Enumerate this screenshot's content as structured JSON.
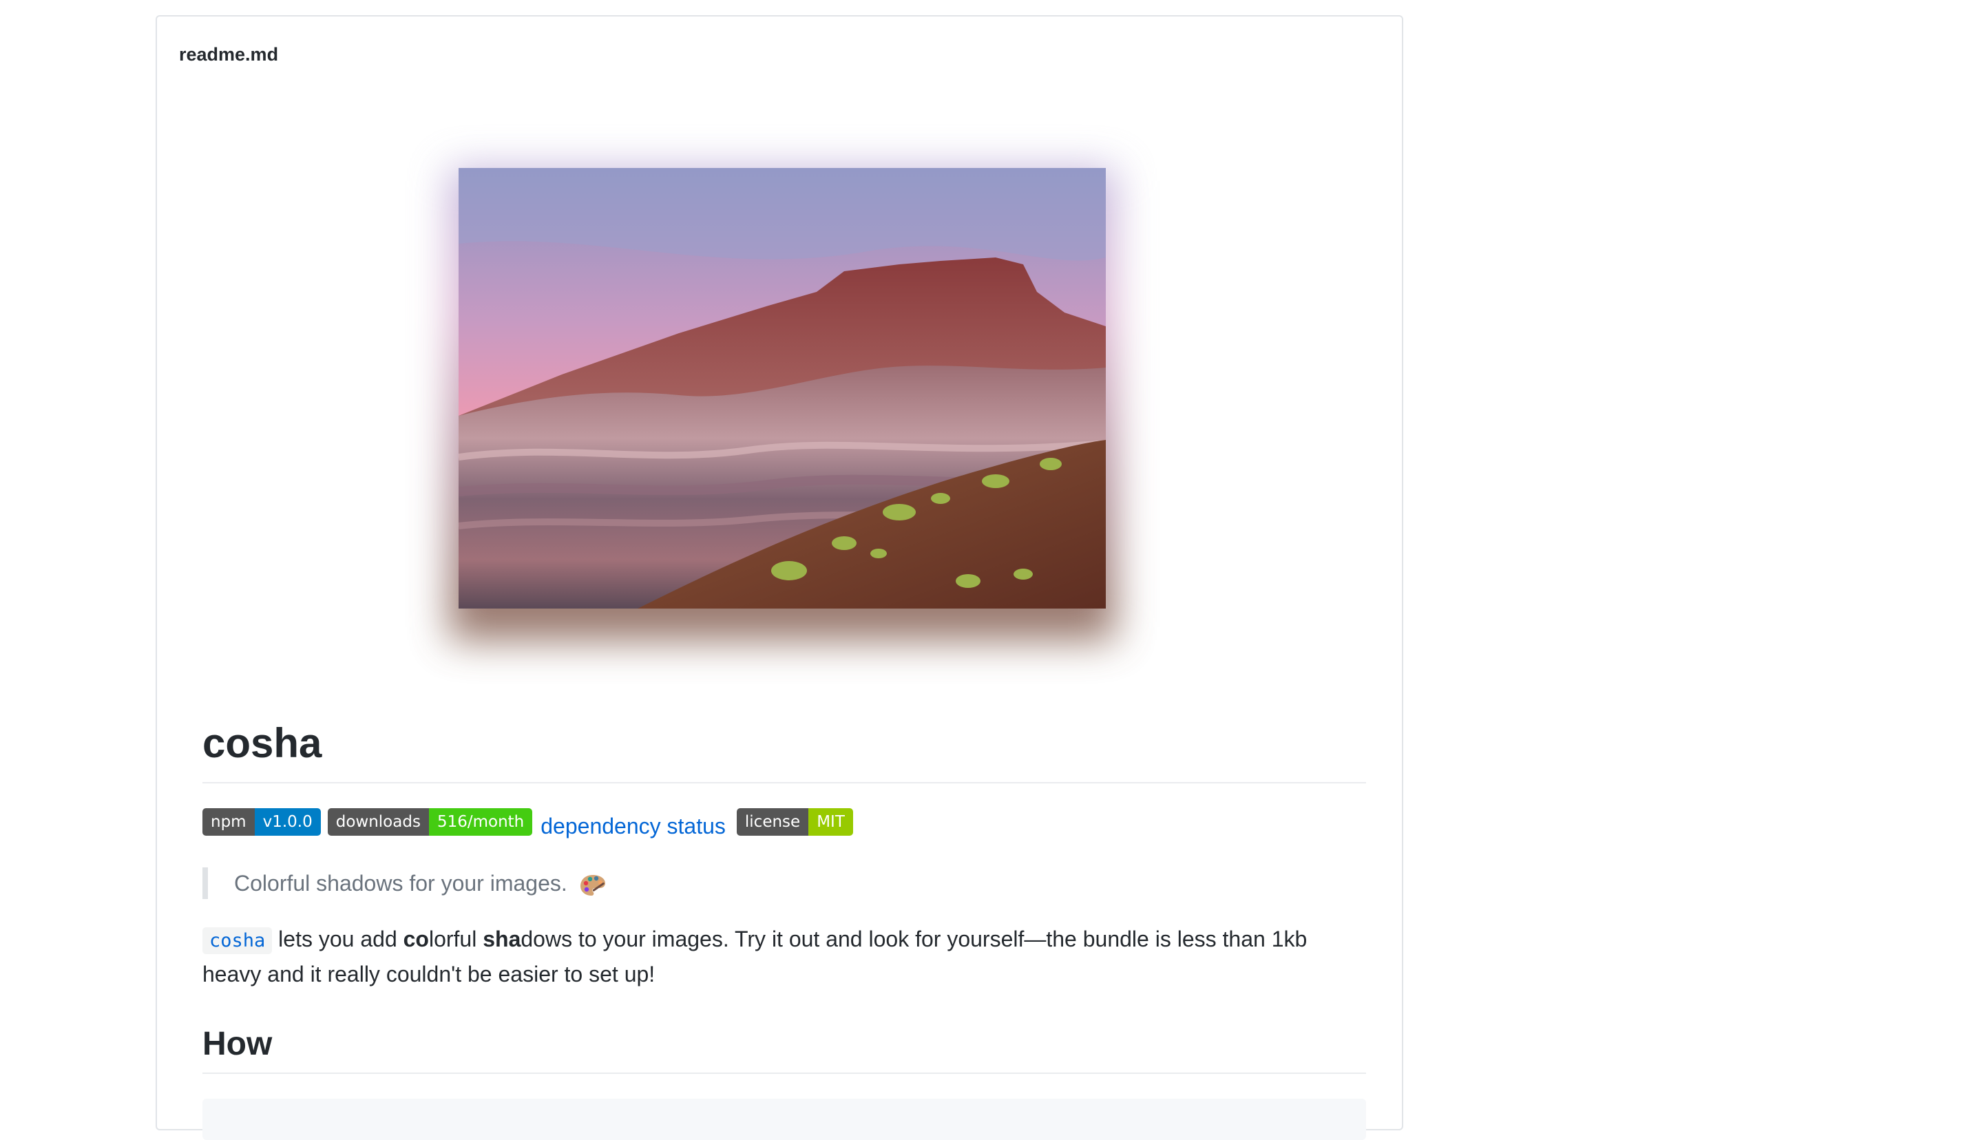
{
  "readme": {
    "filename": "readme.md"
  },
  "hero": {
    "alt": "Painted desert landscape"
  },
  "project": {
    "title": "cosha"
  },
  "badges": [
    {
      "key": "npm",
      "value": "v1.0.0",
      "color": "#007ec6"
    },
    {
      "key": "downloads",
      "value": "516/month",
      "color": "#44cc11"
    },
    {
      "key": "license",
      "value": "MIT",
      "color": "#97ca00"
    }
  ],
  "dependency_link": "dependency status",
  "tagline": "Colorful shadows for your images.",
  "intro": {
    "code": "cosha",
    "t1": " lets you add ",
    "b1": "co",
    "t2": "lorful ",
    "b2": "sha",
    "t3": "dows to your images. Try it out and look for yourself—the bundle is less than 1kb heavy and it really couldn't be easier to set up!"
  },
  "section_how": "How",
  "colors": {
    "link": "#0366d6",
    "text": "#24292e",
    "muted": "#6a737d",
    "border": "#e1e4e8"
  }
}
